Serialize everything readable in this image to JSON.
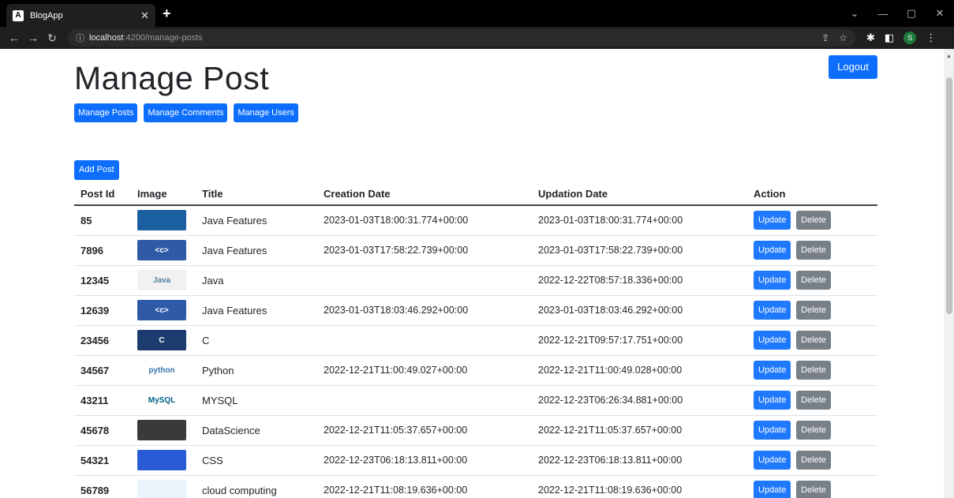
{
  "browser": {
    "tab_title": "BlogApp",
    "tab_icon": "A",
    "url_host": "localhost",
    "url_path": ":4200/manage-posts",
    "avatar_letter": "S"
  },
  "page": {
    "title": "Manage Post",
    "logout_label": "Logout",
    "nav": [
      {
        "label": "Manage Posts"
      },
      {
        "label": "Manage Comments"
      },
      {
        "label": "Manage Users"
      }
    ],
    "add_post_label": "Add Post"
  },
  "table": {
    "headers": {
      "post_id": "Post Id",
      "image": "Image",
      "title": "Title",
      "creation_date": "Creation Date",
      "updation_date": "Updation Date",
      "action": "Action"
    },
    "update_label": "Update",
    "delete_label": "Delete",
    "rows": [
      {
        "id": "85",
        "title": "Java Features",
        "created": "2023-01-03T18:00:31.774+00:00",
        "updated": "2023-01-03T18:00:31.774+00:00",
        "image": "java-features-image",
        "thumb_bg": "#1b5fa0",
        "thumb_fg": "#f2a23a",
        "thumb_text": ""
      },
      {
        "id": "7896",
        "title": "Java Features",
        "created": "2023-01-03T17:58:22.739+00:00",
        "updated": "2023-01-03T17:58:22.739+00:00",
        "image": "c-language-image",
        "thumb_bg": "#2e5aa8",
        "thumb_fg": "#ffffff",
        "thumb_text": "<c>"
      },
      {
        "id": "12345",
        "title": "Java",
        "created": "",
        "updated": "2022-12-22T08:57:18.336+00:00",
        "image": "java-logo-image",
        "thumb_bg": "#f1f1f1",
        "thumb_fg": "#5382a1",
        "thumb_text": "Java"
      },
      {
        "id": "12639",
        "title": "Java Features",
        "created": "2023-01-03T18:03:46.292+00:00",
        "updated": "2023-01-03T18:03:46.292+00:00",
        "image": "c-language-image",
        "thumb_bg": "#2e5aa8",
        "thumb_fg": "#ffffff",
        "thumb_text": "<c>"
      },
      {
        "id": "23456",
        "title": "C",
        "created": "",
        "updated": "2022-12-21T09:57:17.751+00:00",
        "image": "c-logo-image",
        "thumb_bg": "#1c3b6e",
        "thumb_fg": "#ffffff",
        "thumb_text": "C"
      },
      {
        "id": "34567",
        "title": "Python",
        "created": "2022-12-21T11:00:49.027+00:00",
        "updated": "2022-12-21T11:00:49.028+00:00",
        "image": "python-logo-image",
        "thumb_bg": "#ffffff",
        "thumb_fg": "#3776ab",
        "thumb_text": "python"
      },
      {
        "id": "43211",
        "title": "MYSQL",
        "created": "",
        "updated": "2022-12-23T06:26:34.881+00:00",
        "image": "mysql-logo-image",
        "thumb_bg": "#ffffff",
        "thumb_fg": "#00618a",
        "thumb_text": "MySQL"
      },
      {
        "id": "45678",
        "title": "DataScience",
        "created": "2022-12-21T11:05:37.657+00:00",
        "updated": "2022-12-21T11:05:37.657+00:00",
        "image": "datascience-image",
        "thumb_bg": "#3a3a3a",
        "thumb_fg": "#d9c08a",
        "thumb_text": ""
      },
      {
        "id": "54321",
        "title": "CSS",
        "created": "2022-12-23T06:18:13.811+00:00",
        "updated": "2022-12-23T06:18:13.811+00:00",
        "image": "css-logo-image",
        "thumb_bg": "#2a5bd7",
        "thumb_fg": "#ffffff",
        "thumb_text": ""
      },
      {
        "id": "56789",
        "title": "cloud computing",
        "created": "2022-12-21T11:08:19.636+00:00",
        "updated": "2022-12-21T11:08:19.636+00:00",
        "image": "cloud-computing-image",
        "thumb_bg": "#eaf3fb",
        "thumb_fg": "#2a7fd0",
        "thumb_text": ""
      }
    ]
  },
  "colors": {
    "primary": "#0d6efd",
    "secondary": "#6c757d"
  }
}
